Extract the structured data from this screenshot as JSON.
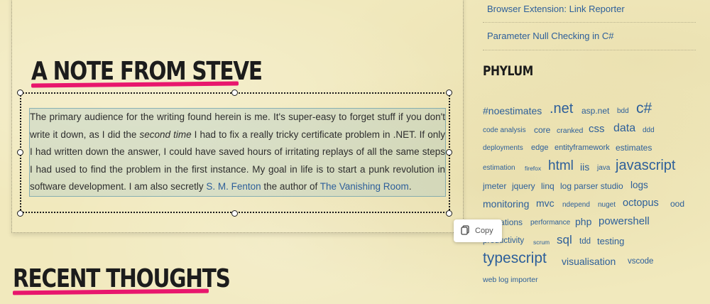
{
  "sidebar": {
    "links": [
      "Browser Extension: Link Reporter",
      "Parameter Null Checking in C#"
    ],
    "phylum_heading": "PHYLUM",
    "tags": [
      {
        "text": "#noestimates"
      },
      {
        "text": ".net"
      },
      {
        "text": "asp.net"
      },
      {
        "text": "bdd"
      },
      {
        "text": "c#"
      },
      {
        "text": "code analysis"
      },
      {
        "text": "core"
      },
      {
        "text": "cranked"
      },
      {
        "text": "css"
      },
      {
        "text": "data"
      },
      {
        "text": "ddd"
      },
      {
        "text": "deployments"
      },
      {
        "text": "edge"
      },
      {
        "text": "entityframework"
      },
      {
        "text": "estimates"
      },
      {
        "text": "estimation"
      },
      {
        "text": "firefox"
      },
      {
        "text": "html"
      },
      {
        "text": "iis"
      },
      {
        "text": "java"
      },
      {
        "text": "javascript"
      },
      {
        "text": "jmeter"
      },
      {
        "text": "jquery"
      },
      {
        "text": "linq"
      },
      {
        "text": "log parser studio"
      },
      {
        "text": "logs"
      },
      {
        "text": "monitoring"
      },
      {
        "text": "mvc"
      },
      {
        "text": "ndepend"
      },
      {
        "text": "nuget"
      },
      {
        "text": "octopus"
      },
      {
        "text": "ood"
      },
      {
        "text": "operations"
      },
      {
        "text": "performance"
      },
      {
        "text": "php"
      },
      {
        "text": "powershell"
      },
      {
        "text": "productivity"
      },
      {
        "text": "scrum"
      },
      {
        "text": "sql"
      },
      {
        "text": "tdd"
      },
      {
        "text": "testing"
      },
      {
        "text": "typescript"
      },
      {
        "text": "visualisation"
      },
      {
        "text": "vscode"
      },
      {
        "text": "web log importer"
      }
    ]
  },
  "note": {
    "heading": "A NOTE FROM STEVE",
    "text_1": "The primary audience for the writing found herein is me. It's super-easy to forget stuff if you don't write it down, as I did the ",
    "text_em": "second time",
    "text_2": " I had to fix a really tricky certificate problem in .NET. If only I had written down the answer, I could have saved hours of irritating replays of all the same steps I had used to find the problem in the first instance. My goal in life is to start a punk revolution in software development. I am also secretly ",
    "link_author": "S. M. Fenton",
    "text_3": " the author of ",
    "link_book": "The Vanishing Room",
    "text_4": "."
  },
  "recent": {
    "heading": "RECENT THOUGHTS"
  },
  "copy_popup": {
    "label": "Copy",
    "icon": "copy-icon"
  },
  "colors": {
    "accent": "#e8176d",
    "link": "#2d5f9a",
    "background": "#f1e9bd"
  }
}
